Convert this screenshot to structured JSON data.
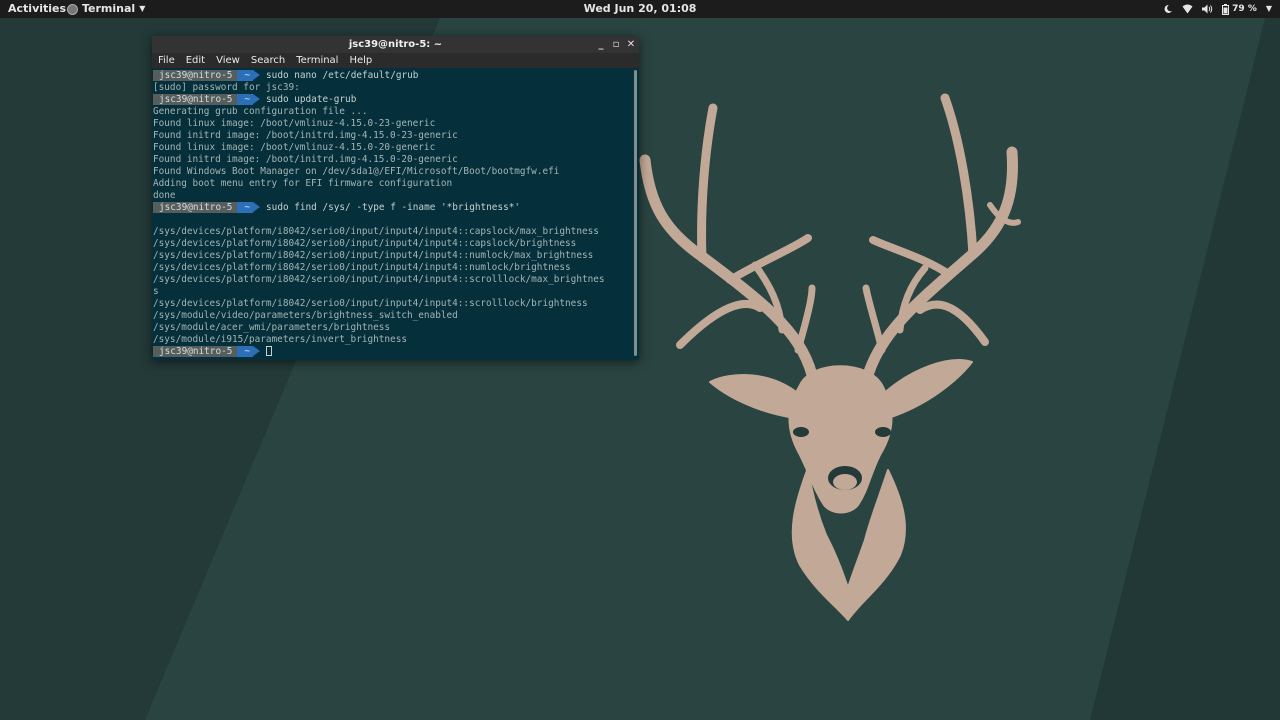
{
  "topbar": {
    "activities": "Activities",
    "app_menu": "Terminal",
    "clock": "Wed Jun 20, 01:08",
    "battery_percent": "79 %",
    "icons": [
      "night-light-icon",
      "wifi-icon",
      "volume-icon",
      "battery-icon"
    ]
  },
  "terminal": {
    "title": "jsc39@nitro-5: ~",
    "controls": {
      "minimize": "_",
      "maximize": "▫",
      "close": "✕"
    },
    "menu": [
      "File",
      "Edit",
      "View",
      "Search",
      "Terminal",
      "Help"
    ],
    "prompt": {
      "user": "jsc39@nitro-5",
      "dir": "~"
    },
    "lines": [
      {
        "type": "prompt",
        "text": "sudo nano /etc/default/grub"
      },
      {
        "type": "output",
        "text": "[sudo] password for jsc39:"
      },
      {
        "type": "prompt",
        "text": "sudo update-grub"
      },
      {
        "type": "output",
        "text": "Generating grub configuration file ..."
      },
      {
        "type": "output",
        "text": "Found linux image: /boot/vmlinuz-4.15.0-23-generic"
      },
      {
        "type": "output",
        "text": "Found initrd image: /boot/initrd.img-4.15.0-23-generic"
      },
      {
        "type": "output",
        "text": "Found linux image: /boot/vmlinuz-4.15.0-20-generic"
      },
      {
        "type": "output",
        "text": "Found initrd image: /boot/initrd.img-4.15.0-20-generic"
      },
      {
        "type": "output",
        "text": "Found Windows Boot Manager on /dev/sda1@/EFI/Microsoft/Boot/bootmgfw.efi"
      },
      {
        "type": "output",
        "text": "Adding boot menu entry for EFI firmware configuration"
      },
      {
        "type": "output",
        "text": "done"
      },
      {
        "type": "prompt",
        "text": "sudo find /sys/ -type f -iname '*brightness*'"
      },
      {
        "type": "output",
        "text": ""
      },
      {
        "type": "output",
        "text": "/sys/devices/platform/i8042/serio0/input/input4/input4::capslock/max_brightness"
      },
      {
        "type": "output",
        "text": "/sys/devices/platform/i8042/serio0/input/input4/input4::capslock/brightness"
      },
      {
        "type": "output",
        "text": "/sys/devices/platform/i8042/serio0/input/input4/input4::numlock/max_brightness"
      },
      {
        "type": "output",
        "text": "/sys/devices/platform/i8042/serio0/input/input4/input4::numlock/brightness"
      },
      {
        "type": "output",
        "text": "/sys/devices/platform/i8042/serio0/input/input4/input4::scrolllock/max_brightnes"
      },
      {
        "type": "output",
        "text": "s"
      },
      {
        "type": "output",
        "text": "/sys/devices/platform/i8042/serio0/input/input4/input4::scrolllock/brightness"
      },
      {
        "type": "output",
        "text": "/sys/module/video/parameters/brightness_switch_enabled"
      },
      {
        "type": "output",
        "text": "/sys/module/acer_wmi/parameters/brightness"
      },
      {
        "type": "output",
        "text": "/sys/module/i915/parameters/invert_brightness"
      },
      {
        "type": "prompt",
        "text": "",
        "cursor": true
      }
    ]
  },
  "colors": {
    "wallpaper_dark": "#233a38",
    "wallpaper_light": "#2a4441",
    "deer": "#c2a896",
    "terminal_bg": "#05303b",
    "prompt_user_bg": "#555d5d",
    "prompt_dir_bg": "#2b6fb8"
  }
}
